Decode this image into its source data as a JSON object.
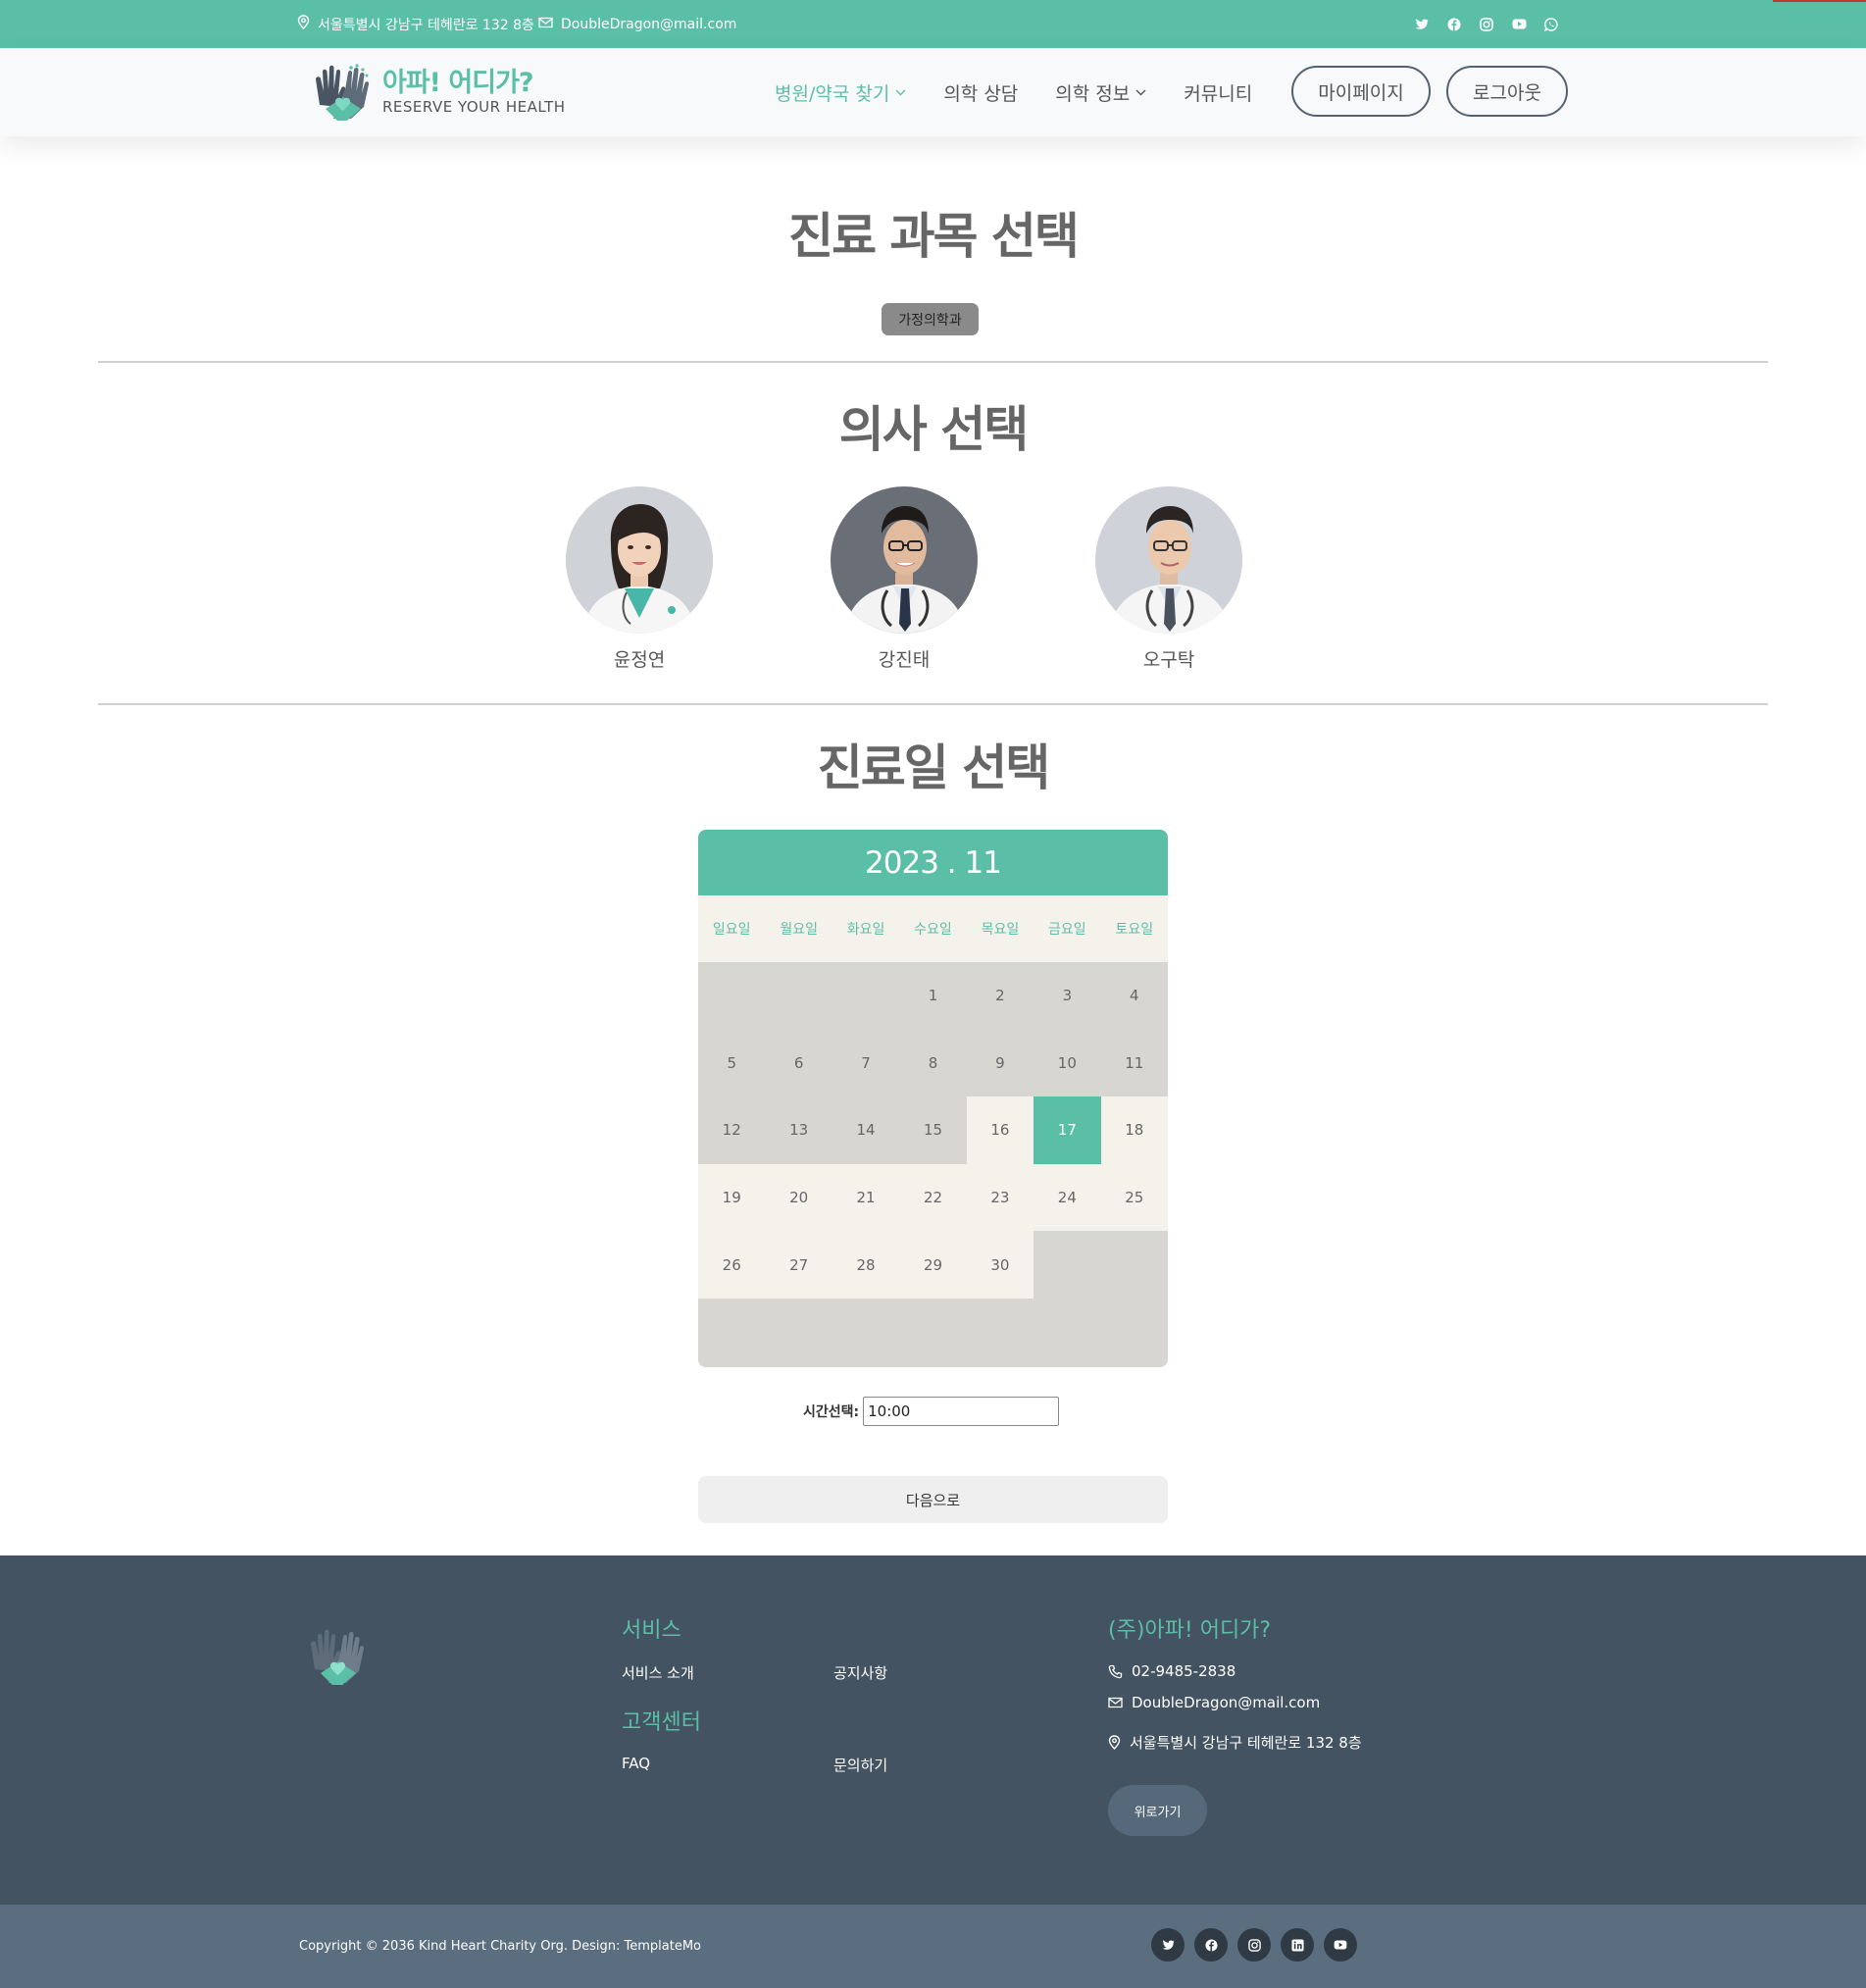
{
  "topbar": {
    "address": "서울특별시 강남구 테헤란로 132 8층",
    "email": "DoubleDragon@mail.com",
    "social_icons": [
      "twitter-icon",
      "facebook-icon",
      "instagram-icon",
      "youtube-icon",
      "whatsapp-icon"
    ]
  },
  "header": {
    "logo_kor": "아파! 어디가?",
    "logo_eng": "RESERVE YOUR HEALTH",
    "nav": [
      {
        "label": "병원/약국 찾기",
        "dropdown": true,
        "active": true
      },
      {
        "label": "의학 상담",
        "dropdown": false
      },
      {
        "label": "의학 정보",
        "dropdown": true
      },
      {
        "label": "커뮤니티",
        "dropdown": false
      }
    ],
    "mypage_label": "마이페이지",
    "logout_label": "로그아웃"
  },
  "department": {
    "title": "진료 과목 선택",
    "selected": "가정의학과"
  },
  "doctors": {
    "title": "의사 선택",
    "list": [
      {
        "name": "윤정연"
      },
      {
        "name": "강진태"
      },
      {
        "name": "오구탁"
      }
    ]
  },
  "date": {
    "title": "진료일 선택",
    "month_label": "2023 . 11",
    "weekdays": [
      "일요일",
      "월요일",
      "화요일",
      "수요일",
      "목요일",
      "금요일",
      "토요일"
    ],
    "leading_blanks": 3,
    "days_in_month": 30,
    "available_days": [
      16,
      18,
      19,
      20,
      21,
      22,
      23,
      24,
      25,
      26,
      27,
      28,
      29,
      30
    ],
    "selected_day": 17
  },
  "time": {
    "label": "시간선택:",
    "value": "10:00"
  },
  "next_label": "다음으로",
  "footer": {
    "services_title": "서비스",
    "service_intro": "서비스 소개",
    "notice": "공지사항",
    "support_title": "고객센터",
    "faq": "FAQ",
    "inquiry": "문의하기",
    "company_title": "(주)아파! 어디가?",
    "phone": "02-9485-2838",
    "email": "DoubleDragon@mail.com",
    "address": "서울특별시 강남구 테헤란로 132 8층",
    "top_button": "위로가기",
    "copyright": "Copyright © 2036 Kind Heart Charity Org. Design: TemplateMo",
    "social_icons": [
      "twitter-icon",
      "facebook-icon",
      "instagram-icon",
      "linkedin-icon",
      "youtube-icon"
    ]
  },
  "colors": {
    "accent": "#5bbfa8",
    "footer_bg": "#435361",
    "copybar_bg": "#5a6e80",
    "calendar_available": "#f5f2eb",
    "calendar_unavailable": "#d7d6d1"
  }
}
